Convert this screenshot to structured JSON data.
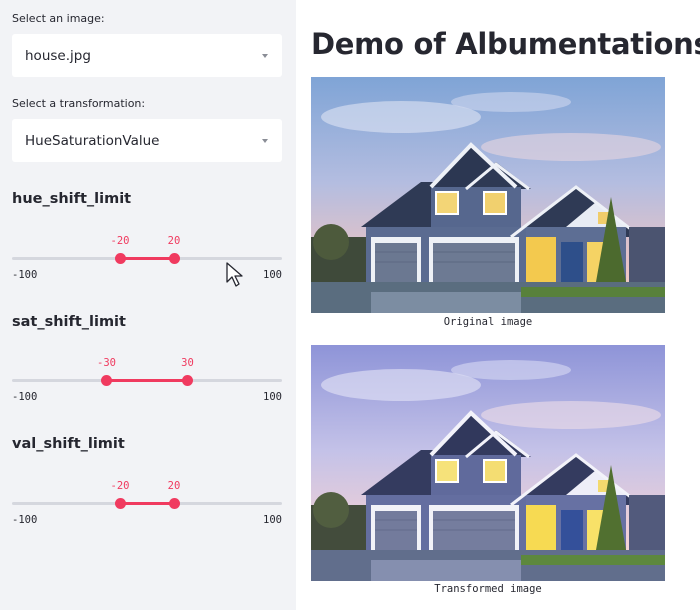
{
  "sidebar": {
    "image_select": {
      "label": "Select an image:",
      "value": "house.jpg"
    },
    "transform_select": {
      "label": "Select a transformation:",
      "value": "HueSaturationValue"
    },
    "params": [
      {
        "name": "hue_shift_limit",
        "min": -100,
        "max": 100,
        "low": -20,
        "high": 20,
        "min_label": "-100",
        "max_label": "100",
        "low_label": "-20",
        "high_label": "20"
      },
      {
        "name": "sat_shift_limit",
        "min": -100,
        "max": 100,
        "low": -30,
        "high": 30,
        "min_label": "-100",
        "max_label": "100",
        "low_label": "-30",
        "high_label": "30"
      },
      {
        "name": "val_shift_limit",
        "min": -100,
        "max": 100,
        "low": -20,
        "high": 20,
        "min_label": "-100",
        "max_label": "100",
        "low_label": "-20",
        "high_label": "20"
      }
    ]
  },
  "main": {
    "title": "Demo of Albumentations",
    "original_caption": "Original image",
    "transformed_caption": "Transformed image"
  },
  "colors": {
    "accent": "#f03a5f",
    "sidebar_bg": "#f2f3f6",
    "track": "#d5d7de"
  }
}
